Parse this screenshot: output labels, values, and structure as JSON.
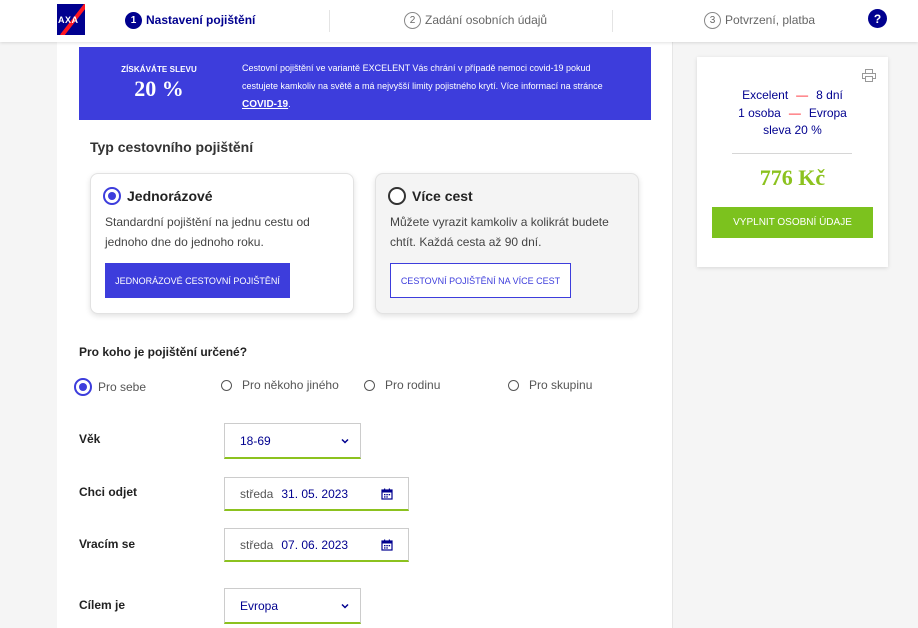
{
  "header": {
    "logo_text": "AXA",
    "steps": [
      {
        "num": "1",
        "label": "Nastavení pojištění",
        "active": true
      },
      {
        "num": "2",
        "label": "Zadání osobních údajů",
        "active": false
      },
      {
        "num": "3",
        "label": "Potvrzení, platba",
        "active": false
      }
    ],
    "help": "?"
  },
  "banner": {
    "discount_label": "ZÍSKÁVÁTE SLEVU",
    "discount_value": "20 %",
    "text": "Cestovní pojištění ve variantě EXCELENT Vás chrání v případě nemoci covid-19 pokud cestujete kamkoliv na světě a má nejvyšší limity pojistného krytí. Více informací na stránce",
    "link": "COVID-19",
    "text_end": "."
  },
  "insurance_type": {
    "title": "Typ cestovního pojištění",
    "options": [
      {
        "title": "Jednorázové",
        "desc": "Standardní pojištění na jednu cestu od jednoho dne do jednoho roku.",
        "button": "JEDNORÁZOVÉ CESTOVNÍ POJIŠTĚNÍ",
        "selected": true
      },
      {
        "title": "Více cest",
        "desc": "Můžete vyrazit kamkoliv a kolikrát budete chtít. Každá cesta až 90 dní.",
        "button": "CESTOVNÍ POJIŠTĚNÍ NA VÍCE CEST",
        "selected": false
      }
    ]
  },
  "who": {
    "title": "Pro koho je pojištění určené?",
    "options": [
      {
        "label": "Pro sebe",
        "selected": true
      },
      {
        "label": "Pro někoho jiného",
        "selected": false
      },
      {
        "label": "Pro rodinu",
        "selected": false
      },
      {
        "label": "Pro skupinu",
        "selected": false
      }
    ]
  },
  "form": {
    "age_label": "Věk",
    "age_value": "18-69",
    "depart_label": "Chci odjet",
    "depart_day": "středa",
    "depart_date": "31. 05. 2023",
    "return_label": "Vracím se",
    "return_day": "středa",
    "return_date": "07. 06. 2023",
    "destination_label": "Cílem je",
    "destination_value": "Evropa"
  },
  "summary": {
    "variant": "Excelent",
    "days": "8 dní",
    "persons": "1 osoba",
    "region": "Evropa",
    "discount": "sleva 20 %",
    "dash": "—",
    "price": "776 Kč",
    "cta": "VYPLNIT OSOBNÍ ÚDAJE"
  },
  "colors": {
    "brand_blue": "#00008f",
    "accent_blue": "#3d3ddc",
    "green": "#8cc21f",
    "red": "#ff1721"
  },
  "icons": [
    "axa-logo",
    "help-icon",
    "print-icon",
    "calendar-icon",
    "chevron-down-icon"
  ]
}
